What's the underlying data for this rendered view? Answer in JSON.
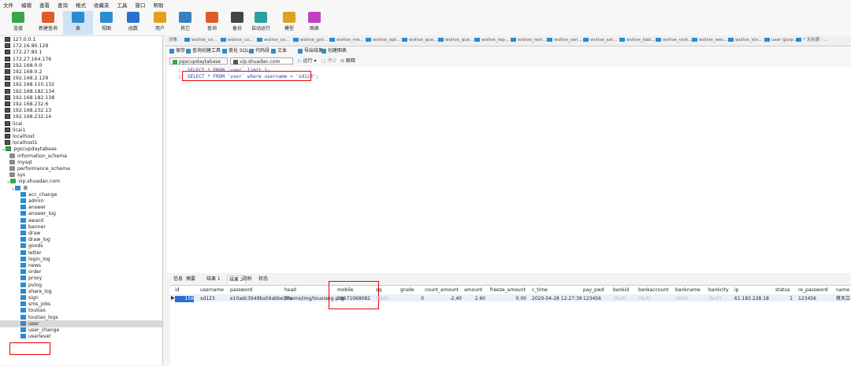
{
  "menu": [
    "文件",
    "编辑",
    "查看",
    "查询",
    "格式",
    "收藏夹",
    "工具",
    "窗口",
    "帮助"
  ],
  "toolbar": [
    {
      "label": "连接",
      "color": "#3aa64a"
    },
    {
      "label": "新建查询",
      "color": "#e05a2a"
    },
    {
      "label": "表",
      "color": "#2a8bd0",
      "active": true
    },
    {
      "label": "视图",
      "color": "#2a8bd0"
    },
    {
      "label": "函数",
      "color": "#2a6fd0"
    },
    {
      "label": "用户",
      "color": "#e0a020"
    },
    {
      "label": "其它",
      "color": "#3a7fc0"
    },
    {
      "label": "查询",
      "color": "#e05a2a"
    },
    {
      "label": "备份",
      "color": "#444444"
    },
    {
      "label": "自动运行",
      "color": "#2aa0a0"
    },
    {
      "label": "模型",
      "color": "#e0a020"
    },
    {
      "label": "图表",
      "color": "#c040c0"
    }
  ],
  "tree": {
    "connections": [
      "127.0.0.1",
      "172.16.80.128",
      "172.27.80.1",
      "172.27.164.176",
      "192.168.0.0",
      "192.168.0.2",
      "192.168.2.129",
      "192.168.110.132",
      "192.168.182.134",
      "192.168.182.138",
      "192.168.232.6",
      "192.168.232.13",
      "192.168.232.14",
      "licai",
      "licai1",
      "localhost",
      "localhost1",
      "pgscupdaytabase"
    ],
    "databases": [
      "information_schema",
      "mysql",
      "performance_schema",
      "sys",
      "vip.shuadan.com"
    ],
    "tables_group": "表",
    "tables": [
      "acc_change",
      "admin",
      "answer",
      "answer_log",
      "award",
      "banner",
      "draw",
      "draw_log",
      "goods",
      "letter",
      "login_log",
      "news",
      "order",
      "proxy",
      "pvlog",
      "share_log",
      "sign",
      "sms_jobs",
      "toutiao",
      "toutiao_logs",
      "user",
      "user_change",
      "userlevel"
    ],
    "selected_table": "user"
  },
  "tabs": {
    "objects_label": "对象",
    "items": [
      "wolive_co...",
      "wolive_co...",
      "wolive_co...",
      "wolive_gro...",
      "wolive_me...",
      "wolive_opt...",
      "wolive_que...",
      "wolive_que...",
      "wolive_rep...",
      "wolive_rest...",
      "wolive_sen...",
      "wolive_ser...",
      "wolive_tabl...",
      "wolive_visit...",
      "wolive_wec...",
      "wolive_sto...",
      "user @vip...",
      "* 无标题 - ..."
    ]
  },
  "query_toolbar": [
    "保存",
    "查询创建工具",
    "美化 SQL",
    "代码段",
    "文本",
    "导出结果",
    "创建图表"
  ],
  "db_bar": {
    "connection": "pgscupdaytabase",
    "database": "vip.shuadan.com",
    "run": "运行",
    "stop": "停止",
    "explain": "解释"
  },
  "editor": {
    "lines": [
      {
        "num": "1",
        "text": "SELECT * FROM `user` limit 1;"
      },
      {
        "num": "2",
        "text": "SELECT * FROM `user` where username = 'xd123';"
      }
    ]
  },
  "result_tabs": [
    "信息",
    "摘要",
    "结果 1",
    "结果 2",
    "剖析",
    "状态"
  ],
  "grid": {
    "columns": [
      "id",
      "username",
      "password",
      "head",
      "mobile",
      "qq",
      "grade",
      "count_amount",
      "amount",
      "freeze_amount",
      "c_time",
      "pay_pwd",
      "bankid",
      "bankaccount",
      "bankname",
      "bankcity",
      "ip",
      "status",
      "re_password",
      "name"
    ],
    "row": {
      "id": "158",
      "username": "xd123",
      "password": "e10adc3949ba59abbe56e",
      "head": "/thems/img/touxiang.png",
      "mobile": "18671068082",
      "qq": "(Null)",
      "grade": "0",
      "count_amount": "-2.40",
      "amount": "2.60",
      "freeze_amount": "0.00",
      "c_time": "2020-04-28 12:27:39",
      "pay_pwd": "123456",
      "bankid": "(Null)",
      "bankaccount": "(Null)",
      "bankname": "(Null)",
      "bankcity": "(Null)",
      "ip": "61.183.228.18",
      "status": "1",
      "re_password": "123456",
      "name": "蒋天立"
    }
  }
}
